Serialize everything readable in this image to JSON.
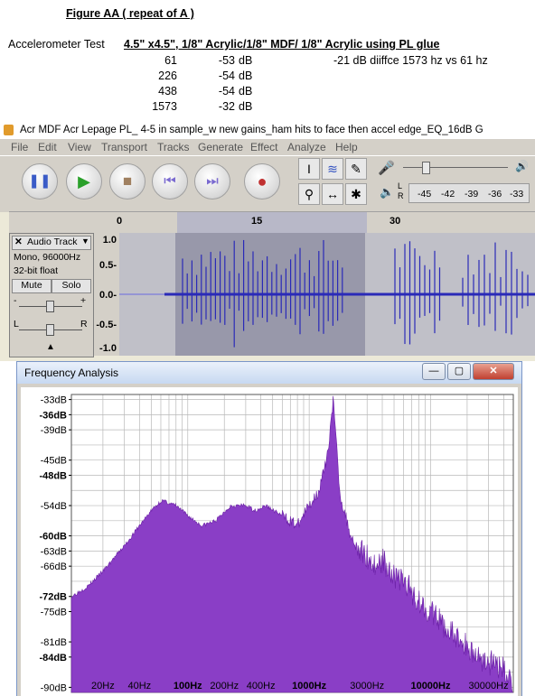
{
  "sheet": {
    "figure_title": "Figure AA ( repeat of A )",
    "test_label": "Accelerometer Test",
    "test_desc": "4.5\" x4.5\", 1/8\" Acrylic/1/8\" MDF/ 1/8\" Acrylic using PL glue",
    "rows": [
      {
        "hz": "61",
        "db": "-53",
        "unit": "dB",
        "note": "-21 dB diiffce 1573 hz vs 61 hz"
      },
      {
        "hz": "226",
        "db": "-54",
        "unit": "dB",
        "note": ""
      },
      {
        "hz": "438",
        "db": "-54",
        "unit": "dB",
        "note": ""
      },
      {
        "hz": "1573",
        "db": "-32",
        "unit": "dB",
        "note": ""
      }
    ]
  },
  "audacity": {
    "window_title": "Acr MDF Acr Lepage PL_ 4-5 in sample_w new gains_ham hits to face then accel edge_EQ_16dB G",
    "menu": [
      "File",
      "Edit",
      "View",
      "Transport",
      "Tracks",
      "Generate",
      "Effect",
      "Analyze",
      "Help"
    ],
    "meter_labels": [
      "-45",
      "-42",
      "-39",
      "-36",
      "-33"
    ],
    "meter_channels": [
      "L",
      "R"
    ],
    "ruler_labels": [
      "0",
      "15",
      "30"
    ],
    "track": {
      "name": "Audio Track",
      "format": "Mono, 96000Hz",
      "bits": "32-bit float",
      "mute": "Mute",
      "solo": "Solo",
      "gain_minus": "-",
      "gain_plus": "+",
      "pan_left": "L",
      "pan_right": "R"
    },
    "vscale": [
      "1.0",
      "0.5-",
      "0.0-",
      "-0.5-",
      "-1.0"
    ]
  },
  "freq": {
    "title": "Frequency Analysis",
    "win_buttons": [
      "—",
      "▢",
      "✕"
    ],
    "db_labels": [
      "-33dB",
      "-36dB",
      "-39dB",
      "-45dB",
      "-48dB",
      "-54dB",
      "-60dB",
      "-63dB",
      "-66dB",
      "-72dB",
      "-75dB",
      "-81dB",
      "-84dB",
      "-90dB"
    ],
    "hz_labels": [
      "20Hz",
      "40Hz",
      "100Hz",
      "200Hz",
      "400Hz",
      "1000Hz",
      "3000Hz",
      "10000Hz",
      "30000Hz"
    ],
    "fill_color": "#8a3ec6",
    "chart_data": {
      "type": "area",
      "x_scale": "log",
      "xlim": [
        11,
        48000
      ],
      "ylim": [
        -91,
        -32
      ],
      "x": [
        11,
        15,
        20,
        30,
        40,
        50,
        61,
        80,
        100,
        130,
        170,
        226,
        300,
        360,
        438,
        600,
        800,
        1000,
        1200,
        1400,
        1573,
        1800,
        2200,
        2600,
        3000,
        3500,
        4000,
        4500,
        5000,
        6000,
        7000,
        8000,
        10000,
        13000,
        16000,
        20000,
        25000,
        30000,
        38000,
        45000,
        48000
      ],
      "y": [
        -72,
        -70,
        -67,
        -62,
        -58,
        -55,
        -53,
        -54,
        -56,
        -58,
        -57,
        -54,
        -54,
        -55,
        -54,
        -56,
        -58,
        -54,
        -51,
        -45,
        -33,
        -52,
        -60,
        -63,
        -64,
        -66,
        -65,
        -66,
        -68,
        -69,
        -71,
        -73,
        -75,
        -78,
        -80,
        -82,
        -84,
        -85,
        -86,
        -88,
        -90
      ]
    }
  }
}
